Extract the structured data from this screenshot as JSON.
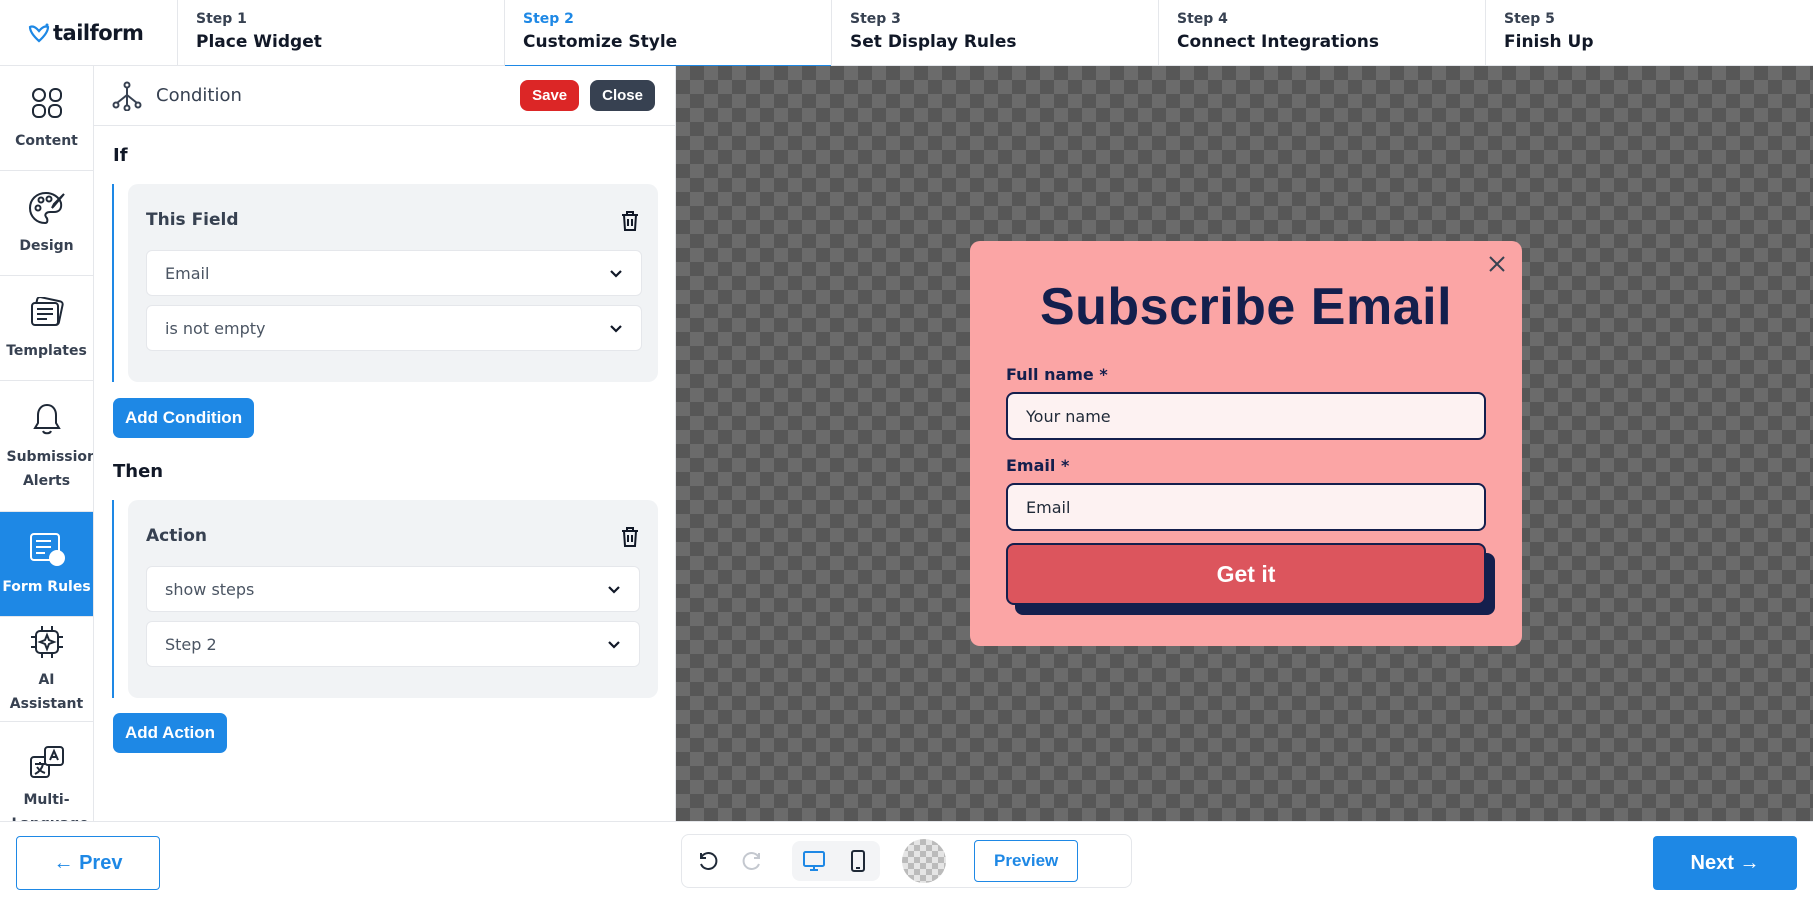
{
  "brand": {
    "logo_text": "tailform",
    "logo_icon": "heart-leaf-icon"
  },
  "steps": [
    {
      "num": "Step 1",
      "name": "Place Widget"
    },
    {
      "num": "Step 2",
      "name": "Customize Style",
      "active": true
    },
    {
      "num": "Step 3",
      "name": "Set Display Rules"
    },
    {
      "num": "Step 4",
      "name": "Connect Integrations"
    },
    {
      "num": "Step 5",
      "name": "Finish Up"
    }
  ],
  "rail": [
    {
      "label": "Content",
      "icon": "grid-icon"
    },
    {
      "label": "Design",
      "icon": "palette-icon"
    },
    {
      "label": "Templates",
      "icon": "templates-icon"
    },
    {
      "label": "Submission Alerts",
      "icon": "bell-icon"
    },
    {
      "label": "Form Rules",
      "icon": "form-rules-icon",
      "active": true
    },
    {
      "label": "AI Assistant",
      "icon": "ai-chip-icon"
    },
    {
      "label": "Multi-Language",
      "icon": "translate-icon"
    }
  ],
  "panel": {
    "title": "Condition",
    "save_label": "Save",
    "close_label": "Close",
    "if_label": "If",
    "condition": {
      "title": "This Field",
      "field": "Email",
      "operator": "is not empty"
    },
    "add_condition_label": "Add Condition",
    "then_label": "Then",
    "action": {
      "title": "Action",
      "type": "show steps",
      "target": "Step 2"
    },
    "add_action_label": "Add Action"
  },
  "popup": {
    "title": "Subscribe Email",
    "fields": [
      {
        "label": "Full name *",
        "placeholder": "Your name"
      },
      {
        "label": "Email *",
        "placeholder": "Email"
      }
    ],
    "button_label": "Get it",
    "colors": {
      "background": "#fba5a5",
      "text": "#141f4d",
      "button": "#dc555d"
    }
  },
  "bottom": {
    "prev_label": "← Prev",
    "preview_label": "Preview",
    "next_label": "Next →"
  },
  "colors": {
    "accent": "#1e88e5",
    "danger": "#dc2626",
    "dark": "#374151"
  }
}
